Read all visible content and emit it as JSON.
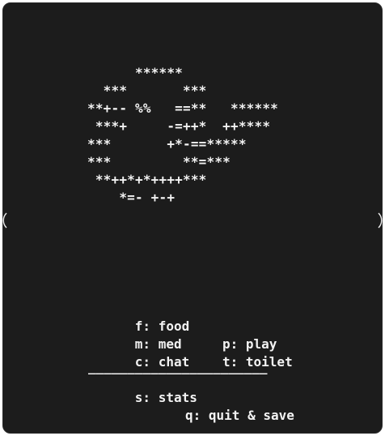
{
  "pet_art": "      ******\n  ***       ***\n**+-- %%   ==**   ******\n ***+     -=++*  ++****\n***       +*-==*****\n***         **=***\n **++*+*++++***\n    *=- +-+",
  "menu": {
    "food": "f: food",
    "play": "p: play",
    "med": "m: med",
    "toilet": "t: toilet",
    "chat": "c: chat"
  },
  "divider": "_______________________",
  "footer": {
    "stats": "s: stats",
    "quit": "q: quit & save"
  },
  "colors": {
    "terminal_background": "#1c1c1c",
    "text": "#f2f2f2",
    "page": "#ffffff"
  }
}
